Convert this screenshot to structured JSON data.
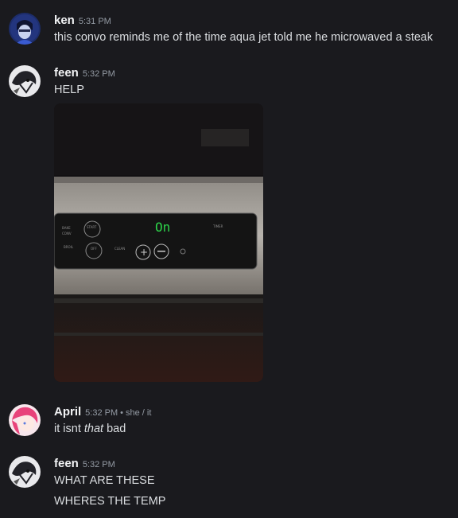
{
  "messages": [
    {
      "author": "ken",
      "time": "5:31 PM",
      "lines": [
        "this convo reminds me of the time aqua jet told me he microwaved a steak"
      ]
    },
    {
      "author": "feen",
      "time": "5:32 PM",
      "lines": [
        "HELP"
      ],
      "attachment": {
        "display_text": "On",
        "panel_labels": [
          "BAKE",
          "CONV",
          "BROIL",
          "START",
          "OFF",
          "CLEAN",
          "TIMER"
        ],
        "display_color": "#2dd44a"
      }
    },
    {
      "author": "April",
      "time": "5:32 PM",
      "pronouns": "she / it",
      "lines": [
        {
          "before": "it isnt ",
          "em": "that",
          "after": " bad"
        }
      ]
    },
    {
      "author": "feen",
      "time": "5:32 PM",
      "lines": [
        "WHAT ARE THESE",
        "WHERES THE TEMP"
      ]
    }
  ],
  "colors": {
    "background": "#1a1a1e",
    "name": "#f2f3f5",
    "text": "#dbdee1",
    "timestamp": "#949ba4"
  }
}
